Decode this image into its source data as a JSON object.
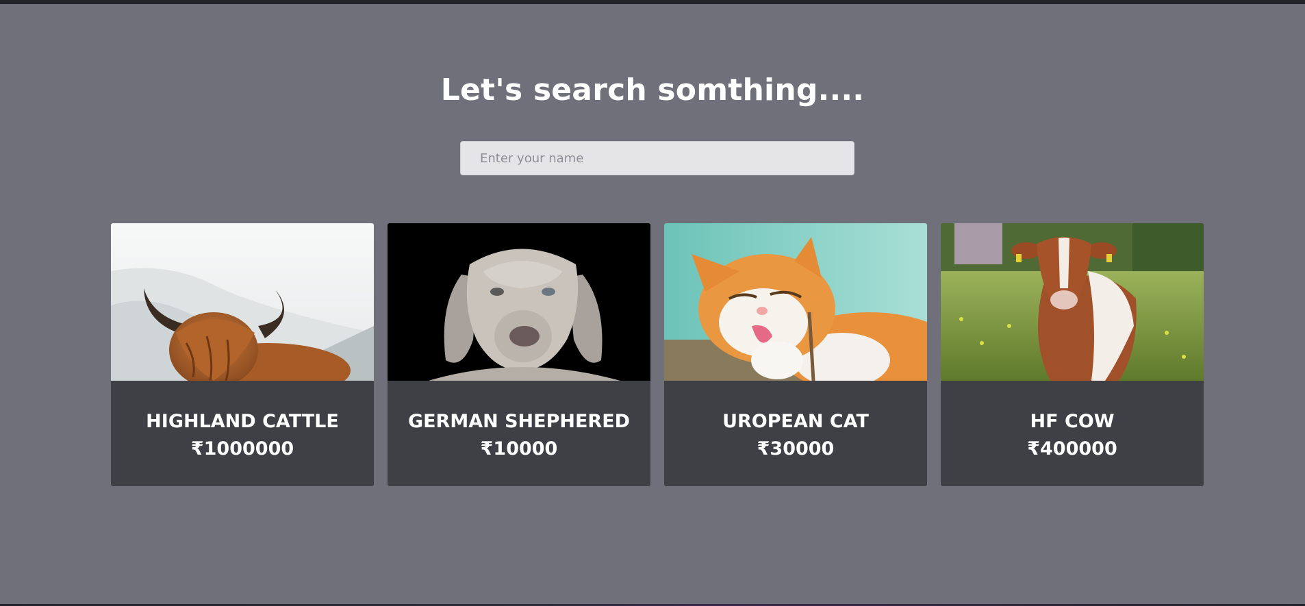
{
  "heading": "Let's search somthing....",
  "search": {
    "placeholder": "Enter your name",
    "value": ""
  },
  "cards": [
    {
      "name": "HIGHLAND CATTLE",
      "price": "₹1000000",
      "image": "highland-cattle-photo"
    },
    {
      "name": "GERMAN SHEPHERED",
      "price": "₹10000",
      "image": "weimaraner-dog-photo"
    },
    {
      "name": "UROPEAN CAT",
      "price": "₹30000",
      "image": "orange-cat-photo"
    },
    {
      "name": "HF COW",
      "price": "₹400000",
      "image": "cow-in-field-photo"
    }
  ],
  "colors": {
    "page_background": "#70707a",
    "card_background": "#3f4046",
    "search_background": "#e5e5e8",
    "text": "#ffffff"
  }
}
